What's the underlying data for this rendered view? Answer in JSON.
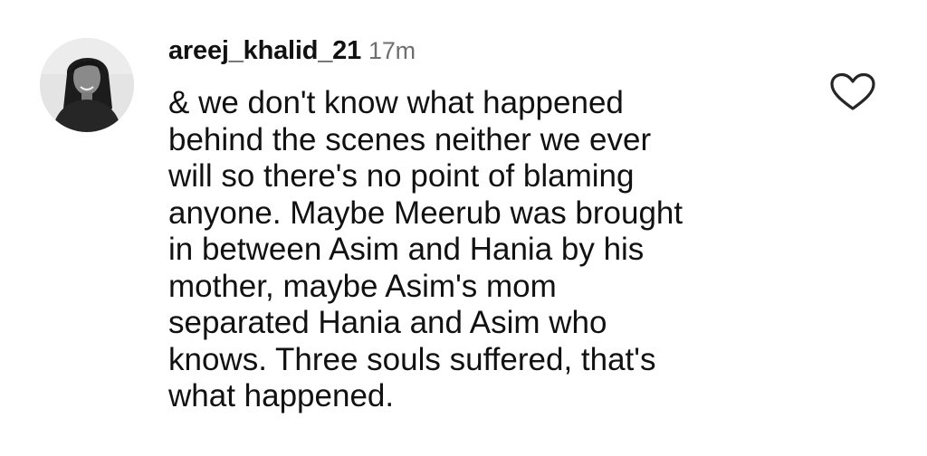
{
  "comment": {
    "username": "areej_khalid_21",
    "timestamp": "17m",
    "text": "& we don't know what happened\nbehind the scenes neither we ever\nwill so there's no point of blaming\nanyone. Maybe Meerub was brought\nin between Asim and Hania by his\nmother, maybe Asim's mom\nseparated Hania and Asim who\nknows. Three souls suffered, that's\nwhat happened.",
    "avatar_icon": "profile-photo",
    "like_icon": "heart-outline-icon"
  },
  "colors": {
    "text": "#111111",
    "timestamp": "#6f6f6f",
    "background": "#ffffff"
  }
}
